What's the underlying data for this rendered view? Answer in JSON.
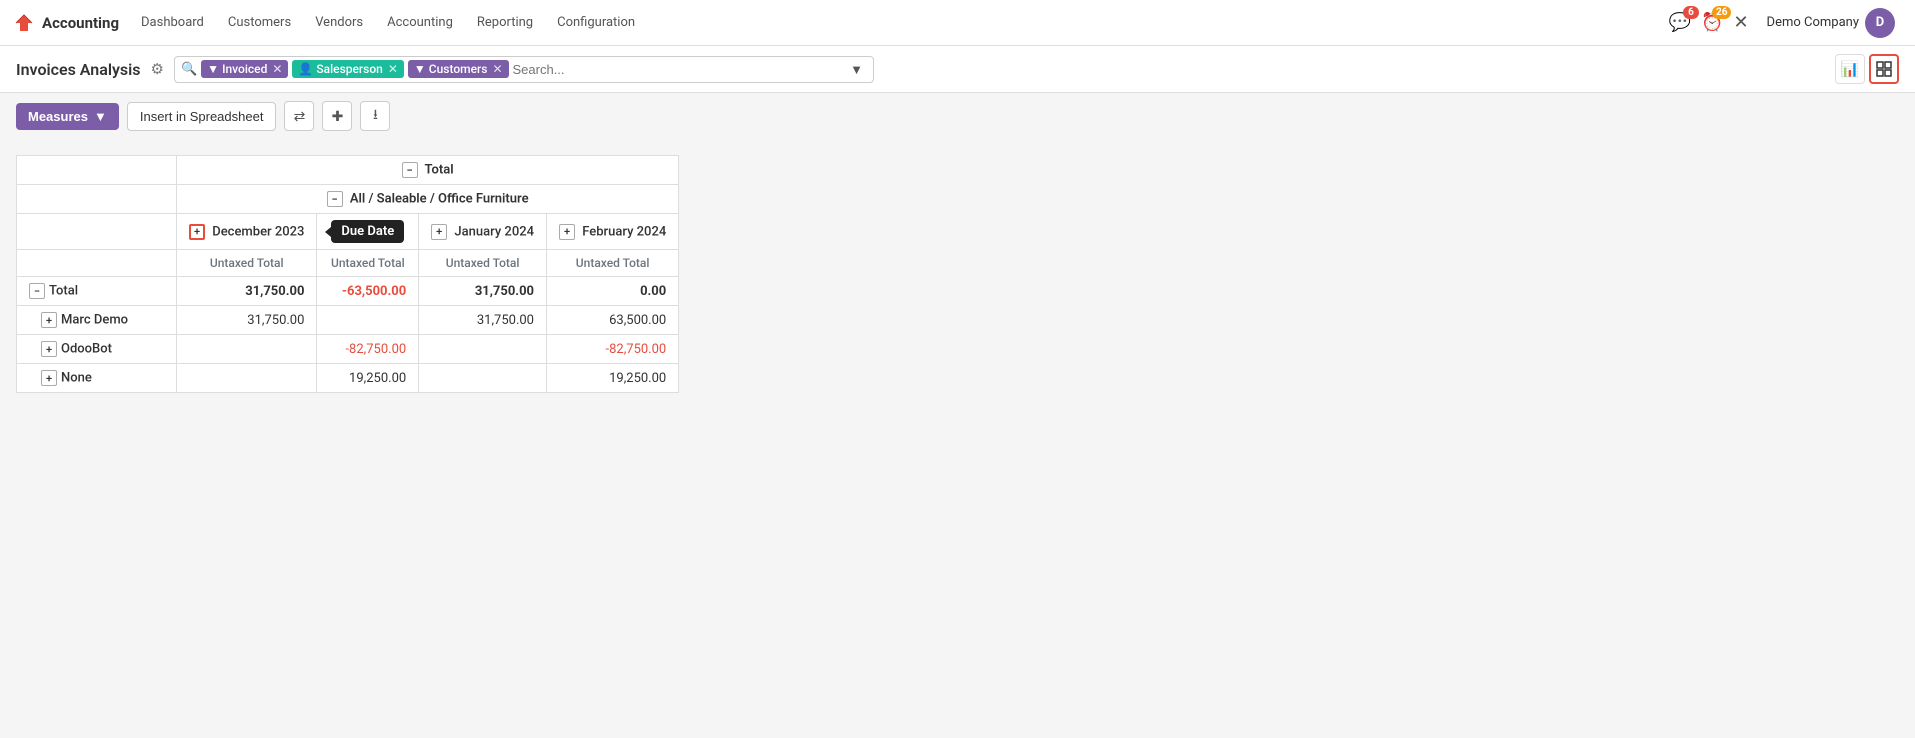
{
  "app": {
    "logo_text": "✕",
    "name": "Accounting"
  },
  "navbar": {
    "menu_items": [
      "Dashboard",
      "Customers",
      "Vendors",
      "Accounting",
      "Reporting",
      "Configuration"
    ],
    "notifications_count": "6",
    "activities_count": "26",
    "company_name": "Demo Company"
  },
  "page_header": {
    "title": "Invoices Analysis",
    "search_filters": [
      {
        "label": "Invoiced",
        "type": "purple"
      },
      {
        "label": "Salesperson",
        "type": "green"
      },
      {
        "label": "Customers",
        "type": "purple"
      }
    ],
    "search_placeholder": "Search..."
  },
  "toolbar": {
    "measures_label": "Measures",
    "insert_label": "Insert in Spreadsheet"
  },
  "pivot": {
    "row_headers": [
      "Total",
      "All / Saleable / Office Furniture"
    ],
    "col_groups": [
      {
        "label": "December 2023",
        "has_expand": true
      },
      {
        "label": "Due Date",
        "tooltip": true
      },
      {
        "label": "January 2024",
        "has_expand": true
      },
      {
        "label": "February 2024",
        "has_expand": true
      }
    ],
    "col_headers": [
      "Untaxed Total",
      "Untaxed Total",
      "Untaxed Total",
      "Untaxed Total"
    ],
    "rows": [
      {
        "label": "Total",
        "expand": "minus",
        "values": [
          "31,750.00",
          "-63,500.00",
          "31,750.00",
          "0.00"
        ],
        "bold": true,
        "negative": [
          false,
          true,
          false,
          false
        ]
      },
      {
        "label": "Marc Demo",
        "expand": "plus",
        "indent": 1,
        "values": [
          "31,750.00",
          "",
          "31,750.00",
          "63,500.00"
        ],
        "bold": false,
        "negative": [
          false,
          false,
          false,
          false
        ]
      },
      {
        "label": "OdooBot",
        "expand": "plus",
        "indent": 1,
        "values": [
          "",
          "-82,750.00",
          "",
          "-82,750.00"
        ],
        "bold": false,
        "negative": [
          false,
          true,
          false,
          true
        ]
      },
      {
        "label": "None",
        "expand": "plus",
        "indent": 1,
        "values": [
          "",
          "19,250.00",
          "",
          "19,250.00"
        ],
        "bold": false,
        "negative": [
          false,
          false,
          false,
          false
        ]
      }
    ]
  }
}
